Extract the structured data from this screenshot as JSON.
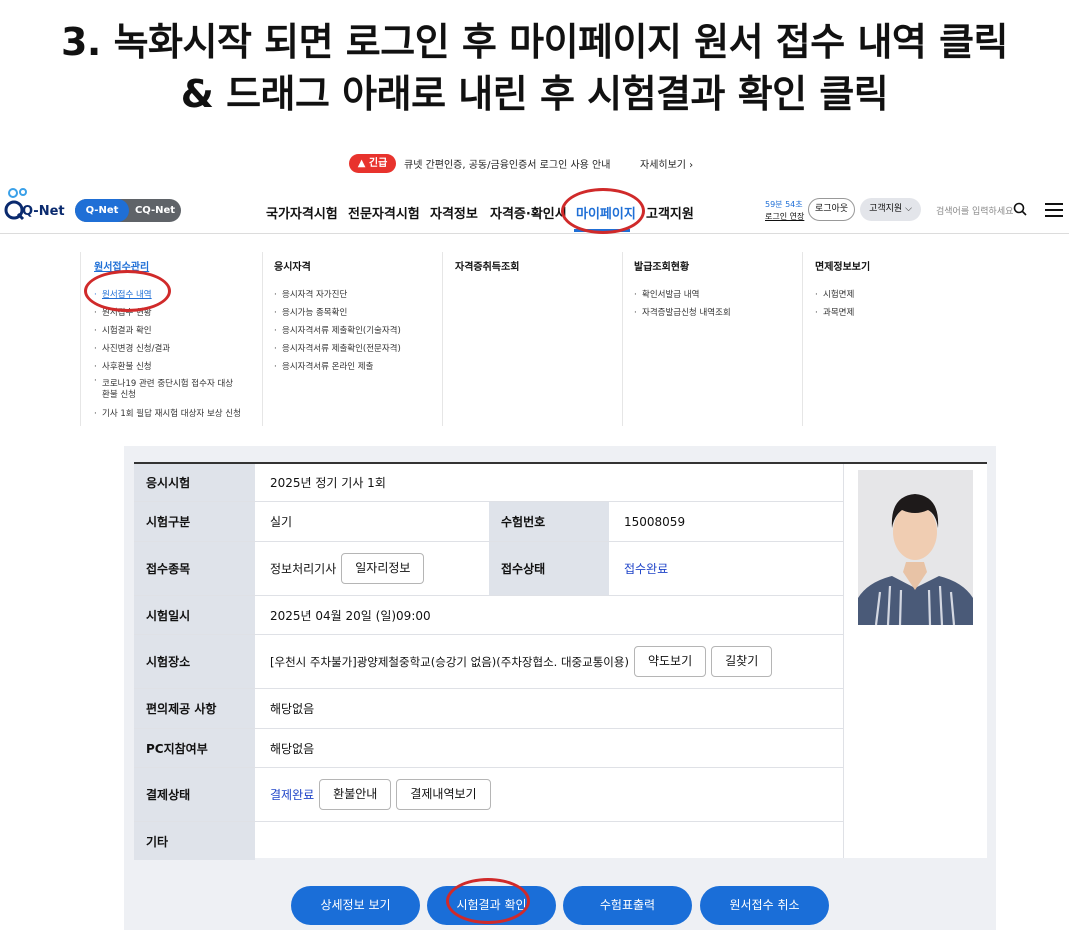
{
  "caption": {
    "line1": "3. 녹화시작 되면 로그인 후 마이페이지 원서 접수 내역 클릭",
    "line2": "& 드래그 아래로 내린 후 시험결과 확인 클릭"
  },
  "notice": {
    "badge": "긴급",
    "text": "큐넷 간편인증, 공동/금융인증서 로그인 사용 안내",
    "more": "자세히보기 ›"
  },
  "header": {
    "logo_text": "Q-Net",
    "toggle_on": "Q-Net",
    "toggle_off": "CQ-Net",
    "nav": [
      "국가자격시험",
      "전문자격시험",
      "자격정보",
      "자격증·확인서",
      "마이페이지",
      "고객지원"
    ],
    "session_time": "59분 54초",
    "session_extend": "로그인 연장",
    "logout": "로그아웃",
    "support": "고객지원",
    "search_placeholder": "검색어를 입력하세요"
  },
  "mega_menu": {
    "col1": {
      "title": "원서접수관리",
      "items": [
        "원서접수 내역",
        "원서접수 현황",
        "시험결과 확인",
        "사진변경 신청/결과",
        "사후환불 신청",
        "코로나19 관련 중단시험 접수자 대상",
        "환불 신청",
        "기사 1회 필답 재시험 대상자 보상 신청"
      ]
    },
    "col2": {
      "title": "응시자격",
      "items": [
        "응시자격 자가진단",
        "응시가능 종목확인",
        "응시자격서류 제출확인(기술자격)",
        "응시자격서류 제출확인(전문자격)",
        "응시자격서류 온라인 제출"
      ]
    },
    "col3": {
      "title": "자격증취득조회",
      "items": []
    },
    "col4": {
      "title": "발급조회현황",
      "items": [
        "확인서발급 내역",
        "자격증발급신청 내역조회"
      ]
    },
    "col5": {
      "title": "면제정보보기",
      "items": [
        "시험면제",
        "과목면제"
      ]
    }
  },
  "detail": {
    "exam_label": "응시시험",
    "exam_value": "2025년 정기 기사 1회",
    "type_label": "시험구분",
    "type_value": "실기",
    "number_label": "수험번호",
    "number_value": "15008059",
    "subject_label": "접수종목",
    "subject_value": "정보처리기사",
    "job_btn": "일자리정보",
    "status_label": "접수상태",
    "status_value": "접수완료",
    "date_label": "시험일시",
    "date_value": "2025년 04월 20일 (일)09:00",
    "place_label": "시험장소",
    "place_value": "[우천시 주차불가]광양제철중학교(승강기 없음)(주차장협소. 대중교통이용)",
    "map_btn": "약도보기",
    "route_btn": "길찾기",
    "conv_label": "편의제공 사항",
    "conv_value": "해당없음",
    "pc_label": "PC지참여부",
    "pc_value": "해당없음",
    "pay_label": "결제상태",
    "pay_value": "결제완료",
    "refund_btn": "환불안내",
    "payhist_btn": "결제내역보기",
    "etc_label": "기타",
    "etc_value": ""
  },
  "actions": [
    "상세정보 보기",
    "시험결과 확인",
    "수험표출력",
    "원서접수 취소"
  ],
  "colors": {
    "accent": "#1f6fd6",
    "highlight": "#d02a2a",
    "urgent": "#e8332d"
  }
}
